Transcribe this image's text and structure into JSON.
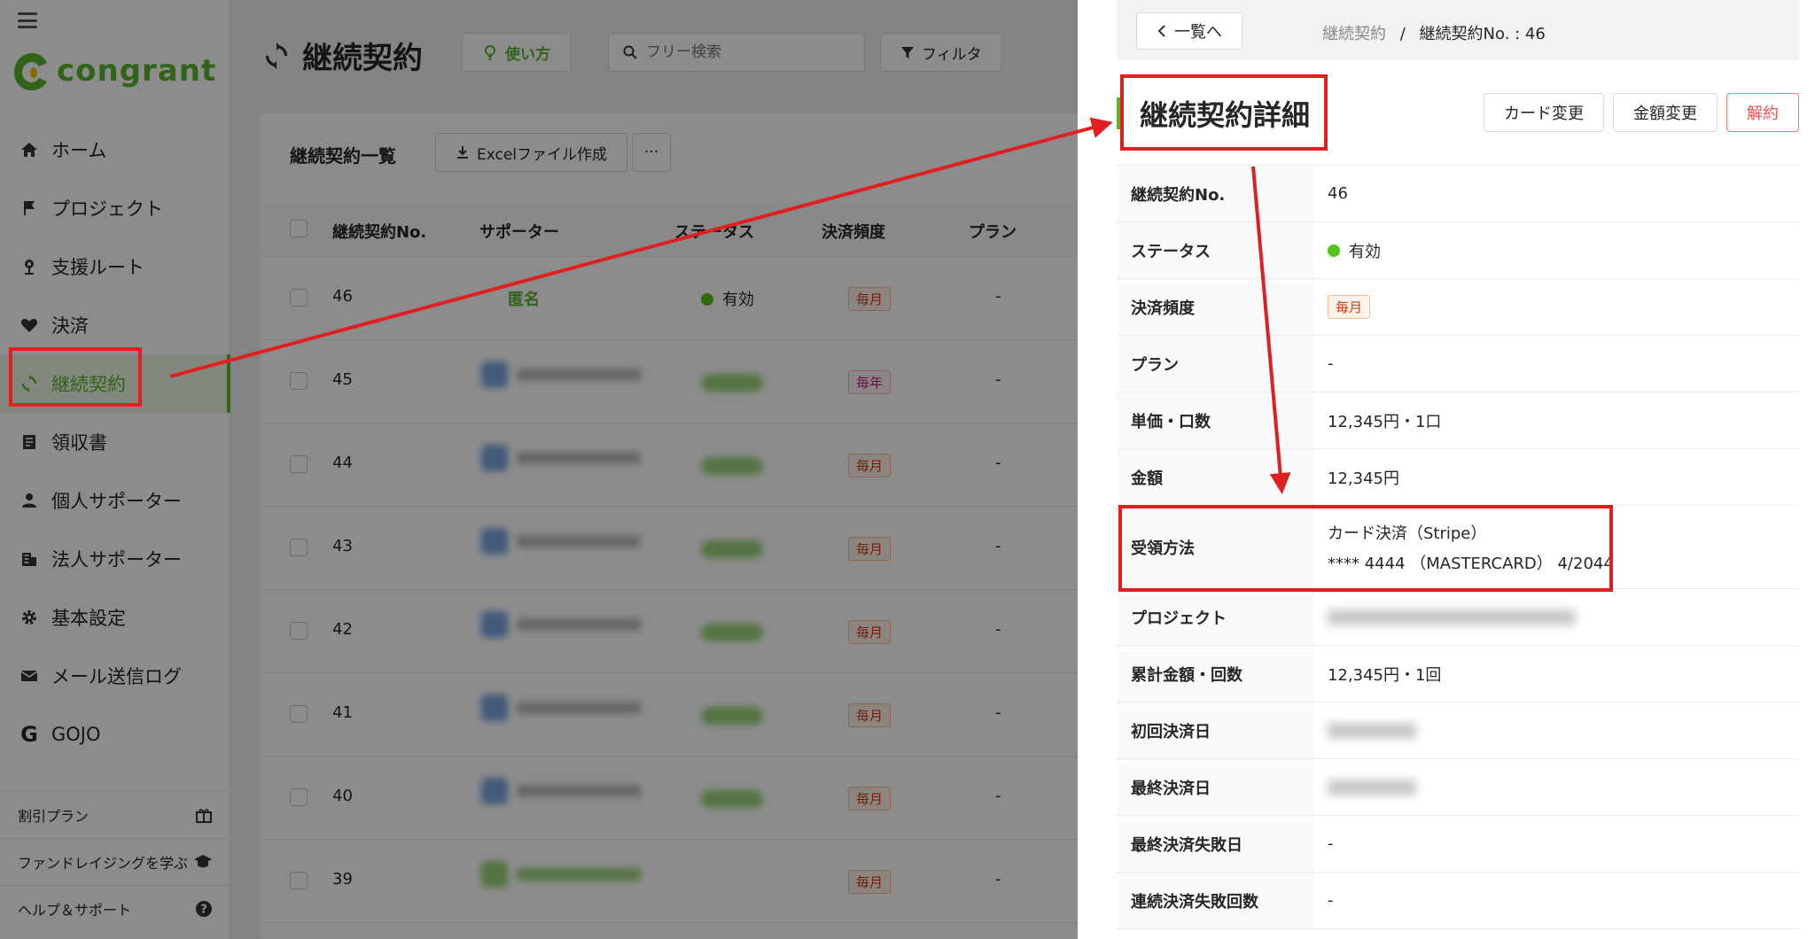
{
  "app": {
    "brand": "congrant",
    "accent": "#5ab52e"
  },
  "sidebar": {
    "items": [
      {
        "label": "ホーム",
        "icon": "home-icon"
      },
      {
        "label": "プロジェクト",
        "icon": "flag-icon"
      },
      {
        "label": "支援ルート",
        "icon": "pin-icon"
      },
      {
        "label": "決済",
        "icon": "heart-icon"
      },
      {
        "label": "継続契約",
        "icon": "sync-icon"
      },
      {
        "label": "領収書",
        "icon": "receipt-icon"
      },
      {
        "label": "個人サポーター",
        "icon": "person-icon"
      },
      {
        "label": "法人サポーター",
        "icon": "building-icon"
      },
      {
        "label": "基本設定",
        "icon": "gear-icon"
      },
      {
        "label": "メール送信ログ",
        "icon": "mail-icon"
      },
      {
        "label": "GOJO",
        "icon": "gojo-icon"
      }
    ],
    "bottom": [
      {
        "label": "割引プラン",
        "icon": "gift-icon"
      },
      {
        "label": "ファンドレイジングを学ぶ",
        "icon": "graduation-icon"
      },
      {
        "label": "ヘルプ＆サポート",
        "icon": "help-icon"
      }
    ]
  },
  "main": {
    "title": "継続契約",
    "usage_label": "使い方",
    "search_placeholder": "フリー検索",
    "filter_label": "フィルタ",
    "list_title": "継続契約一覧",
    "excel_label": "Excelファイル作成",
    "more_label": "···",
    "columns": [
      "継続契約No.",
      "サポーター",
      "ステータス",
      "決済頻度",
      "プラン"
    ],
    "rows": [
      {
        "no": "46",
        "supporter": "匿名",
        "status": "有効",
        "freq": "毎月",
        "plan": "-"
      },
      {
        "no": "45",
        "freq": "毎年",
        "plan": "-"
      },
      {
        "no": "44",
        "freq": "毎月",
        "plan": "-"
      },
      {
        "no": "43",
        "freq": "毎月",
        "plan": "-"
      },
      {
        "no": "42",
        "freq": "毎月",
        "plan": "-"
      },
      {
        "no": "41",
        "freq": "毎月",
        "plan": "-"
      },
      {
        "no": "40",
        "freq": "毎月",
        "plan": "-"
      },
      {
        "no": "39",
        "freq": "毎月",
        "plan": "-"
      }
    ]
  },
  "drawer": {
    "back_label": "一覧へ",
    "breadcrumb": {
      "parent": "継続契約",
      "sep": "/",
      "current": "継続契約No. : 46"
    },
    "title": "継続契約詳細",
    "buttons": {
      "card_change": "カード変更",
      "amount_change": "金額変更",
      "cancel": "解約"
    },
    "fields": [
      {
        "label": "継続契約No.",
        "value": "46"
      },
      {
        "label": "ステータス",
        "value": "有効"
      },
      {
        "label": "決済頻度",
        "value": "毎月"
      },
      {
        "label": "プラン",
        "value": "-"
      },
      {
        "label": "単価・口数",
        "value": "12,345円・1口"
      },
      {
        "label": "金額",
        "value": "12,345円"
      },
      {
        "label": "受領方法",
        "value": "カード決済（Stripe）",
        "value2": "**** 4444 （MASTERCARD） 4/2044"
      },
      {
        "label": "プロジェクト",
        "value": ""
      },
      {
        "label": "累計金額・回数",
        "value": "12,345円・1回"
      },
      {
        "label": "初回決済日",
        "value": ""
      },
      {
        "label": "最終決済日",
        "value": ""
      },
      {
        "label": "最終決済失敗日",
        "value": "-"
      },
      {
        "label": "連続決済失敗回数",
        "value": "-"
      }
    ]
  }
}
